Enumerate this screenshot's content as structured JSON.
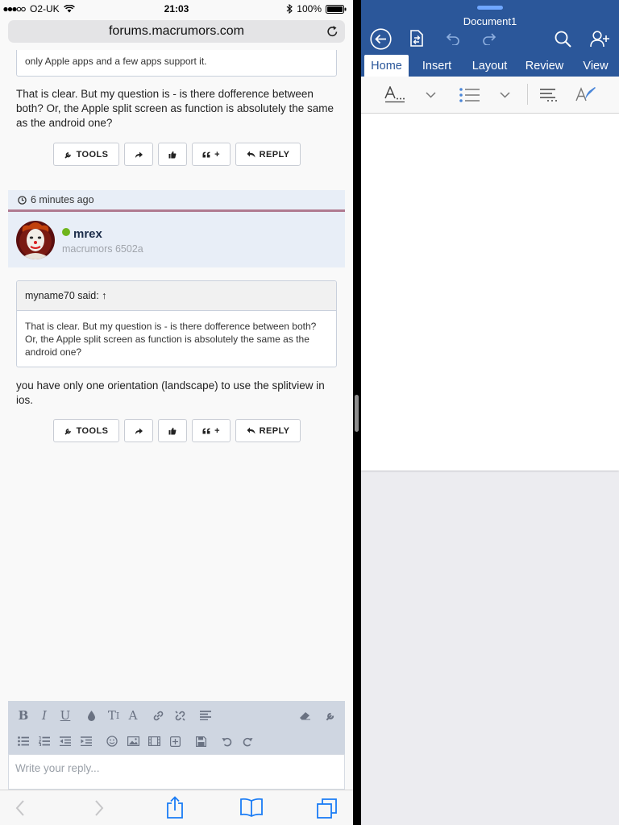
{
  "status": {
    "carrier": "O2-UK",
    "time": "21:03",
    "battery": "100%"
  },
  "safari": {
    "url": "forums.macrumors.com"
  },
  "post1": {
    "quote_tail": "only Apple apps and a few apps support it.",
    "text": "That is clear. But my question is - is there dofference between both? Or, the Apple split screen as function is absolutely the same as the android one?"
  },
  "actions": {
    "tools": "TOOLS",
    "reply": "REPLY",
    "quote_plus": "+"
  },
  "post2": {
    "time_ago": "6 minutes ago",
    "username": "mrex",
    "user_title": "macrumors 6502a",
    "quote_author": "myname70 said: ↑",
    "quote_text": "That is clear. But my question is - is there dofference between both? Or, the Apple split screen as function is absolutely the same as the android one?",
    "text": "you have only one orientation (landscape) to use the splitview in ios."
  },
  "editor": {
    "placeholder": "Write your reply..."
  },
  "word": {
    "title": "Document1",
    "tabs": [
      "Home",
      "Insert",
      "Layout",
      "Review",
      "View"
    ],
    "active_tab": "Home"
  },
  "colors": {
    "word_blue": "#2b579a",
    "forum_navy": "#1c2d4a",
    "online_green": "#6fb51c",
    "safari_blue": "#1a7cf5"
  }
}
